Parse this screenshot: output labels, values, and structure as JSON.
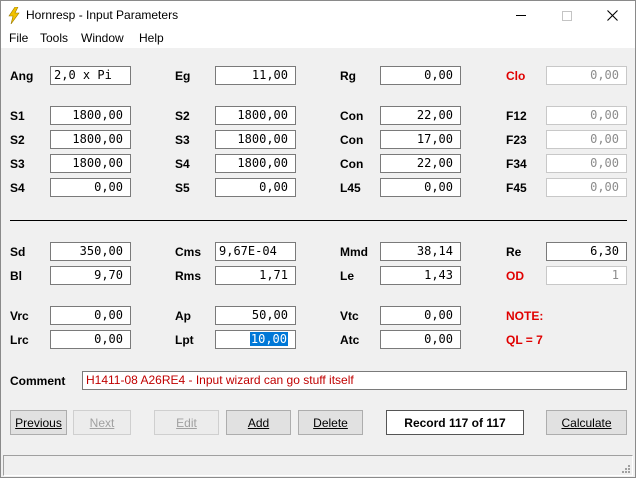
{
  "window": {
    "title": "Hornresp - Input Parameters",
    "controls": {
      "minimize": "minimize",
      "maximize": "maximize",
      "close": "close"
    }
  },
  "menu": [
    "File",
    "Tools",
    "Window",
    "Help"
  ],
  "params": {
    "row1": [
      {
        "label": "Ang",
        "value": "2,0 x Pi",
        "red": false,
        "disabled": false
      },
      {
        "label": "Eg",
        "value": "11,00",
        "red": false,
        "disabled": false
      },
      {
        "label": "Rg",
        "value": "0,00",
        "red": false,
        "disabled": false
      },
      {
        "label": "Clo",
        "value": "0,00",
        "red": true,
        "disabled": true
      }
    ],
    "horn": [
      [
        {
          "label": "S1",
          "value": "1800,00"
        },
        {
          "label": "S2",
          "value": "1800,00"
        },
        {
          "label": "Con",
          "value": "22,00"
        },
        {
          "label": "F12",
          "value": "0,00"
        }
      ],
      [
        {
          "label": "S2",
          "value": "1800,00"
        },
        {
          "label": "S3",
          "value": "1800,00"
        },
        {
          "label": "Con",
          "value": "17,00"
        },
        {
          "label": "F23",
          "value": "0,00"
        }
      ],
      [
        {
          "label": "S3",
          "value": "1800,00"
        },
        {
          "label": "S4",
          "value": "1800,00"
        },
        {
          "label": "Con",
          "value": "22,00"
        },
        {
          "label": "F34",
          "value": "0,00"
        }
      ],
      [
        {
          "label": "S4",
          "value": "0,00"
        },
        {
          "label": "S5",
          "value": "0,00"
        },
        {
          "label": "L45",
          "value": "0,00"
        },
        {
          "label": "F45",
          "value": "0,00"
        }
      ]
    ],
    "driver": [
      [
        {
          "label": "Sd",
          "value": "350,00"
        },
        {
          "label": "Cms",
          "value": "9,67E-04"
        },
        {
          "label": "Mmd",
          "value": "38,14"
        },
        {
          "label": "Re",
          "value": "6,30"
        }
      ],
      [
        {
          "label": "Bl",
          "value": "9,70"
        },
        {
          "label": "Rms",
          "value": "1,71"
        },
        {
          "label": "Le",
          "value": "1,43"
        },
        {
          "label": "OD",
          "value": "1"
        }
      ]
    ],
    "chamber": [
      [
        {
          "label": "Vrc",
          "value": "0,00"
        },
        {
          "label": "Ap",
          "value": "50,00"
        },
        {
          "label": "Vtc",
          "value": "0,00"
        },
        {
          "label": "NOTE:",
          "value": ""
        }
      ],
      [
        {
          "label": "Lrc",
          "value": "0,00"
        },
        {
          "label": "Lpt",
          "value": "10,00"
        },
        {
          "label": "Atc",
          "value": "0,00"
        },
        {
          "label": "QL = 7",
          "value": ""
        }
      ]
    ]
  },
  "comment": {
    "label": "Comment",
    "value": "H1411-08 A26RE4 - Input wizard can go stuff itself"
  },
  "buttons": {
    "previous": "Previous",
    "next": "Next",
    "edit": "Edit",
    "add": "Add",
    "delete": "Delete",
    "record": "Record 117 of 117",
    "calculate": "Calculate"
  },
  "colors": {
    "accent_red": "#e00000",
    "selection": "#0078d7",
    "comment_text": "#c00000"
  },
  "icons": {
    "app": "lightning-icon"
  }
}
